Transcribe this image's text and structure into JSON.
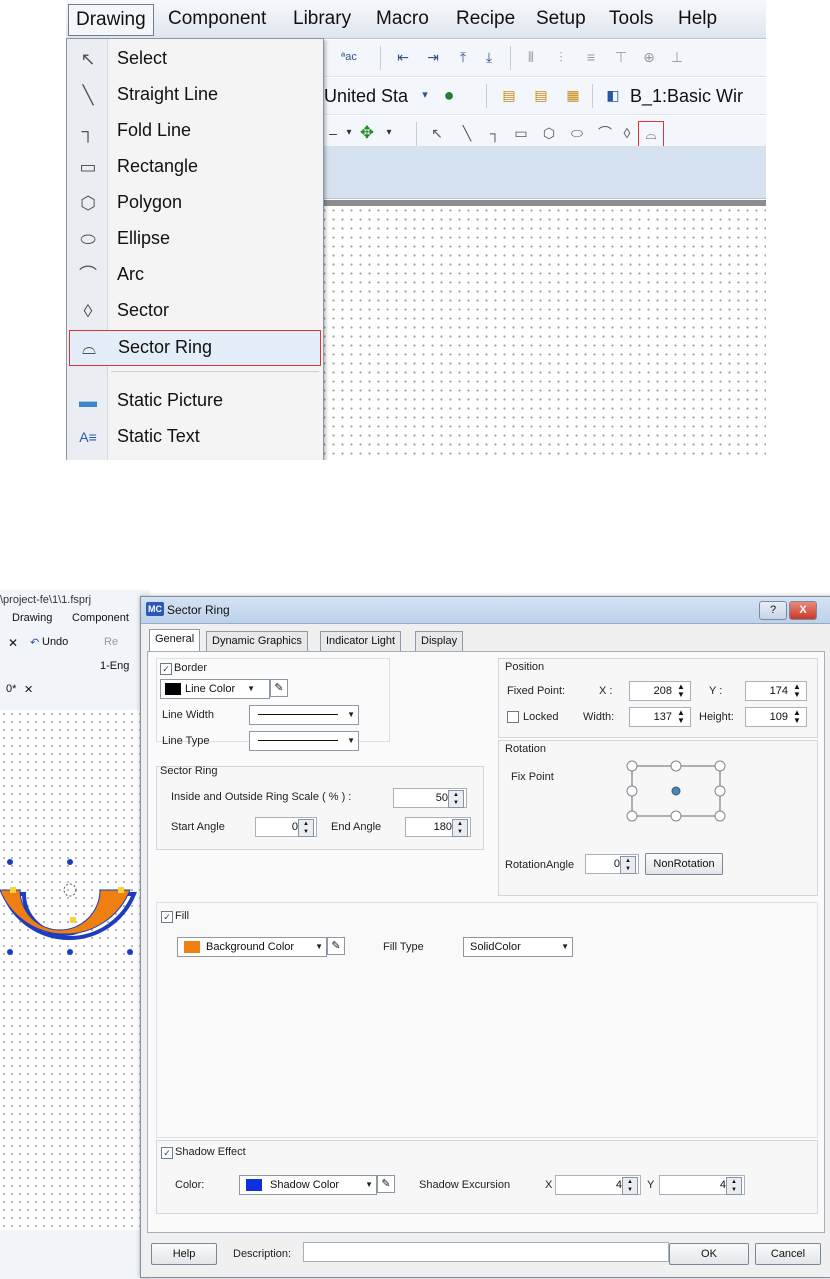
{
  "menubar": {
    "items": [
      "Drawing",
      "Component",
      "Library",
      "Macro",
      "Recipe",
      "Setup",
      "Tools",
      "Help"
    ]
  },
  "toolbar": {
    "language_combo": "United Sta",
    "window_label": "B_1:Basic Wir"
  },
  "drawing_menu": {
    "items": [
      {
        "label": "Select",
        "icon": "cursor-arrow-icon"
      },
      {
        "label": "Straight Line",
        "icon": "straight-line-icon"
      },
      {
        "label": "Fold Line",
        "icon": "fold-line-icon"
      },
      {
        "label": "Rectangle",
        "icon": "rectangle-icon"
      },
      {
        "label": "Polygon",
        "icon": "polygon-icon"
      },
      {
        "label": "Ellipse",
        "icon": "ellipse-icon"
      },
      {
        "label": "Arc",
        "icon": "arc-icon"
      },
      {
        "label": "Sector",
        "icon": "sector-icon"
      },
      {
        "label": "Sector Ring",
        "icon": "sector-ring-icon"
      },
      {
        "label": "Static Picture",
        "icon": "picture-icon"
      },
      {
        "label": "Static Text",
        "icon": "text-icon"
      }
    ],
    "highlight_color": "#d33333"
  },
  "background_app": {
    "title_path": "\\project-fe\\1\\1.fsprj",
    "menu": [
      "Drawing",
      "Component"
    ],
    "undo_label": "Undo",
    "redo_label": "Re",
    "lang_label": "1-Eng",
    "tab_label": "0*",
    "shape_fill": "#f07f12",
    "shape_border": "#1c3dbf"
  },
  "dialog": {
    "logo": "MC",
    "title": "Sector Ring",
    "help_btn": "?",
    "close_btn": "X",
    "tabs": [
      "General",
      "Dynamic Graphics",
      "Indicator Light",
      "Display"
    ],
    "border": {
      "label": "Border",
      "checked": true,
      "line_color_label": "Line Color",
      "line_color": "#000000",
      "line_width_label": "Line Width",
      "line_type_label": "Line Type"
    },
    "position": {
      "label": "Position",
      "fixed_point_label": "Fixed Point:",
      "x_label": "X :",
      "x_value": "208",
      "y_label": "Y :",
      "y_value": "174",
      "locked_label": "Locked",
      "locked": false,
      "width_label": "Width:",
      "width_value": "137",
      "height_label": "Height:",
      "height_value": "109"
    },
    "rotation": {
      "label": "Rotation",
      "fix_point_label": "Fix Point",
      "angle_label": "RotationAngle",
      "angle_value": "0",
      "nonrotation_label": "NonRotation"
    },
    "sector_ring": {
      "label": "Sector Ring",
      "scale_label": "Inside and Outside Ring Scale ( % ) :",
      "scale_value": "50",
      "start_angle_label": "Start Angle",
      "start_angle_value": "0",
      "end_angle_label": "End Angle",
      "end_angle_value": "180"
    },
    "fill": {
      "label": "Fill",
      "checked": true,
      "bg_color_label": "Background Color",
      "bg_color": "#f07f12",
      "fill_type_label": "Fill Type",
      "fill_type_value": "SolidColor"
    },
    "shadow": {
      "label": "Shadow Effect",
      "checked": true,
      "color_label": "Color:",
      "shadow_color_label": "Shadow Color",
      "shadow_color": "#1030e0",
      "excursion_label": "Shadow Excursion",
      "x_label": "X",
      "x_value": "4",
      "y_label": "Y",
      "y_value": "4"
    },
    "footer": {
      "help_label": "Help",
      "description_label": "Description:",
      "description_value": "",
      "ok_label": "OK",
      "cancel_label": "Cancel"
    }
  }
}
